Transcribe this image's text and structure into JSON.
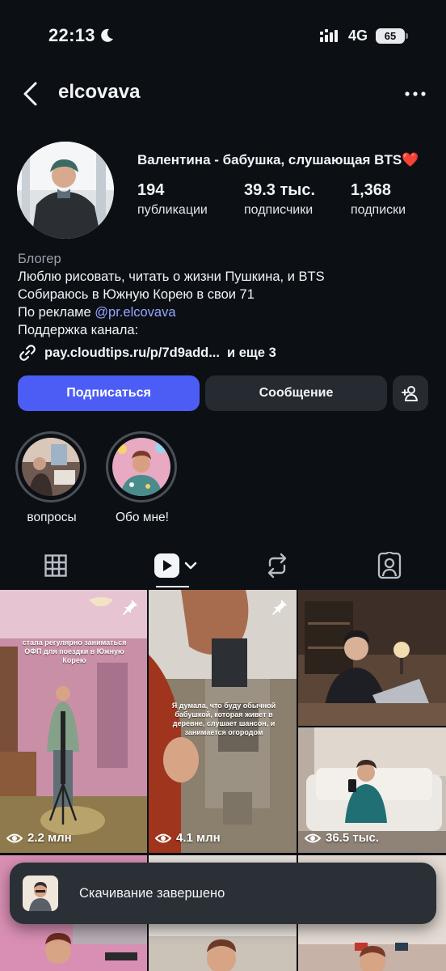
{
  "status_bar": {
    "time": "22:13",
    "network": "4G",
    "battery": "65"
  },
  "header": {
    "username": "elcovava"
  },
  "profile": {
    "display_name": "Валентина  - бабушка, слушающая BTS❤️",
    "stats": [
      {
        "value": "194",
        "label": "публикации"
      },
      {
        "value": "39.3 тыс.",
        "label": "подписчики"
      },
      {
        "value": "1,368",
        "label": "подписки"
      }
    ],
    "bio": {
      "category": "Блогер",
      "line1": "Люблю рисовать, читать о жизни Пушкина, и BTS",
      "line2": "Собираюсь в Южную Корею в свои 71",
      "line3_prefix": "По рекламе ",
      "line3_mention": "@pr.elcovava",
      "line4": "Поддержка канала:"
    },
    "link": {
      "text": "pay.cloudtips.ru/p/7d9add...",
      "more": "и еще 3"
    }
  },
  "buttons": {
    "follow": "Подписаться",
    "message": "Сообщение"
  },
  "highlights": [
    {
      "label": "вопросы"
    },
    {
      "label": "Обо мне!"
    }
  ],
  "grid": {
    "tiles": [
      {
        "views": "2.2 млн",
        "caption": "стала регулярно заниматься ОФП для поездки в Южную Корею",
        "pinned": true
      },
      {
        "views": "4.1 млн",
        "caption": "Я думала, что буду обычной бабушкой, которая живет в деревне, слушает шансон, и занимается огородом",
        "pinned": true
      },
      {
        "views": "",
        "caption": "",
        "pinned": false
      },
      {
        "views": "36.5 тыс.",
        "caption": "",
        "pinned": false
      }
    ]
  },
  "toast": {
    "text": "Скачивание завершено"
  },
  "colors": {
    "background": "#0c0f14",
    "accent": "#4c5df6",
    "mention": "#93a8ff",
    "button_secondary": "#262a31"
  }
}
